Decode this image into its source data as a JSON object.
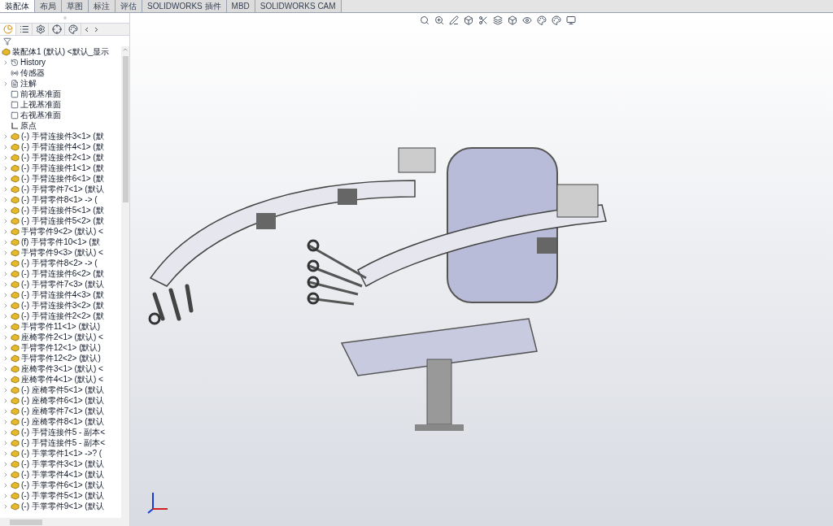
{
  "tabs": [
    {
      "label": "装配体",
      "selected": true
    },
    {
      "label": "布局",
      "selected": false
    },
    {
      "label": "草图",
      "selected": false
    },
    {
      "label": "标注",
      "selected": false
    },
    {
      "label": "评估",
      "selected": false
    },
    {
      "label": "SOLIDWORKS 插件",
      "selected": false
    },
    {
      "label": "MBD",
      "selected": false
    },
    {
      "label": "SOLIDWORKS CAM",
      "selected": false
    }
  ],
  "panel_tabs": [
    {
      "kind": "feature",
      "selected": true
    },
    {
      "kind": "property",
      "selected": false
    },
    {
      "kind": "config",
      "selected": false
    },
    {
      "kind": "dim",
      "selected": false
    },
    {
      "kind": "display",
      "selected": false
    }
  ],
  "tree": {
    "root": "装配体1 (默认) <默认_显示",
    "items": [
      {
        "label": "History",
        "kind": "history",
        "expandable": true
      },
      {
        "label": "传感器",
        "kind": "sensor",
        "expandable": false
      },
      {
        "label": "注解",
        "kind": "annotation",
        "expandable": true
      },
      {
        "label": "前视基准面",
        "kind": "plane",
        "expandable": false
      },
      {
        "label": "上视基准面",
        "kind": "plane",
        "expandable": false
      },
      {
        "label": "右视基准面",
        "kind": "plane",
        "expandable": false
      },
      {
        "label": "原点",
        "kind": "origin",
        "expandable": false
      },
      {
        "label": "(-) 手臂连接件3<1> (默",
        "kind": "part",
        "expandable": true
      },
      {
        "label": "(-) 手臂连接件4<1> (默",
        "kind": "part",
        "expandable": true
      },
      {
        "label": "(-) 手臂连接件2<1> (默",
        "kind": "part",
        "expandable": true
      },
      {
        "label": "(-) 手臂连接件1<1> (默",
        "kind": "part",
        "expandable": true
      },
      {
        "label": "(-) 手臂连接件6<1> (默",
        "kind": "part",
        "expandable": true
      },
      {
        "label": "(-) 手臂零件7<1> (默认",
        "kind": "part",
        "expandable": true
      },
      {
        "label": "(-) 手臂零件8<1> -> (",
        "kind": "part",
        "expandable": true
      },
      {
        "label": "(-) 手臂连接件5<1> (默",
        "kind": "part",
        "expandable": true
      },
      {
        "label": "(-) 手臂连接件5<2> (默",
        "kind": "part",
        "expandable": true
      },
      {
        "label": "手臂零件9<2> (默认) <",
        "kind": "part",
        "expandable": true
      },
      {
        "label": "(f) 手臂零件10<1> (默",
        "kind": "part",
        "expandable": true
      },
      {
        "label": "手臂零件9<3> (默认) <",
        "kind": "part",
        "expandable": true
      },
      {
        "label": "(-) 手臂零件8<2> -> (",
        "kind": "part",
        "expandable": true
      },
      {
        "label": "(-) 手臂连接件6<2> (默",
        "kind": "part",
        "expandable": true
      },
      {
        "label": "(-) 手臂零件7<3> (默认",
        "kind": "part",
        "expandable": true
      },
      {
        "label": "(-) 手臂连接件4<3> (默",
        "kind": "part",
        "expandable": true
      },
      {
        "label": "(-) 手臂连接件3<2> (默",
        "kind": "part",
        "expandable": true
      },
      {
        "label": "(-) 手臂连接件2<2> (默",
        "kind": "part",
        "expandable": true
      },
      {
        "label": "手臂零件11<1> (默认)",
        "kind": "part",
        "expandable": true
      },
      {
        "label": "座椅零件2<1> (默认) <",
        "kind": "part",
        "expandable": true
      },
      {
        "label": "手臂零件12<1> (默认)",
        "kind": "part",
        "expandable": true
      },
      {
        "label": "手臂零件12<2> (默认)",
        "kind": "part",
        "expandable": true
      },
      {
        "label": "座椅零件3<1> (默认) <",
        "kind": "part",
        "expandable": true
      },
      {
        "label": "座椅零件4<1> (默认) <",
        "kind": "part",
        "expandable": true
      },
      {
        "label": "(-) 座椅零件5<1> (默认",
        "kind": "part",
        "expandable": true
      },
      {
        "label": "(-) 座椅零件6<1> (默认",
        "kind": "part",
        "expandable": true
      },
      {
        "label": "(-) 座椅零件7<1> (默认",
        "kind": "part",
        "expandable": true
      },
      {
        "label": "(-) 座椅零件8<1> (默认",
        "kind": "part",
        "expandable": true
      },
      {
        "label": "(-) 手臂连接件5 - 副本<",
        "kind": "part",
        "expandable": true
      },
      {
        "label": "(-) 手臂连接件5 - 副本<",
        "kind": "part",
        "expandable": true
      },
      {
        "label": "(-) 手掌零件1<1> ->? (",
        "kind": "part",
        "expandable": true
      },
      {
        "label": "(-) 手掌零件3<1> (默认",
        "kind": "part",
        "expandable": true
      },
      {
        "label": "(-) 手掌零件4<1> (默认",
        "kind": "part",
        "expandable": true
      },
      {
        "label": "(-) 手掌零件6<1> (默认",
        "kind": "part",
        "expandable": true
      },
      {
        "label": "(-) 手掌零件5<1> (默认",
        "kind": "part",
        "expandable": true
      },
      {
        "label": "(-) 手掌零件9<1> (默认",
        "kind": "part",
        "expandable": true
      }
    ]
  }
}
